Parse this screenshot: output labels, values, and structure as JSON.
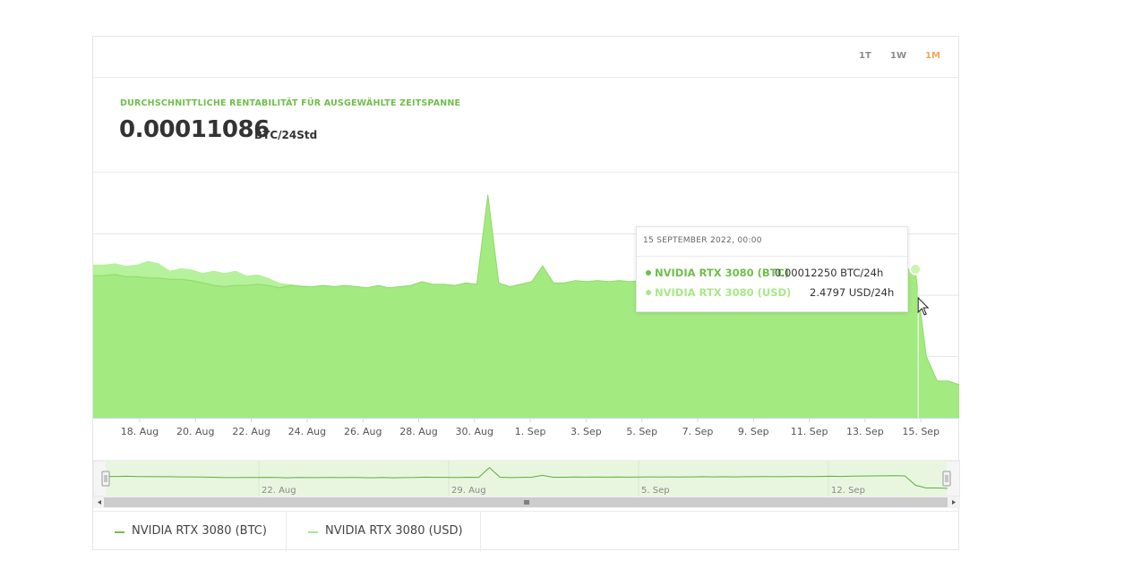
{
  "range_buttons": [
    {
      "label": "1T",
      "active": false
    },
    {
      "label": "1W",
      "active": false
    },
    {
      "label": "1M",
      "active": true
    }
  ],
  "summary": {
    "label": "DURCHSCHNITTLICHE RENTABILITÄT FÜR AUSGEWÄHLTE ZEITSPANNE",
    "value": "0.00011086",
    "unit": "BTC/24Std"
  },
  "tooltip": {
    "date": "15 SEPTEMBER 2022, 00:00",
    "rows": [
      {
        "name": "NVIDIA RTX 3080 (BTC)",
        "value": "0.00012250 BTC/24h",
        "color": "#6fbf4a"
      },
      {
        "name": "NVIDIA RTX 3080 (USD)",
        "value": "2.4797 USD/24h",
        "color": "#a8e88a"
      }
    ]
  },
  "legend": [
    {
      "label": "NVIDIA RTX 3080 (BTC)",
      "color": "#6fbf4a"
    },
    {
      "label": "NVIDIA RTX 3080 (USD)",
      "color": "#a8e88a"
    }
  ],
  "colors": {
    "btc_fill": "#a3ea80",
    "usd_fill": "#b6f19b",
    "line": "#5fae3d",
    "navigator_bg": "#e8f6e0",
    "range_active": "#f4a55a"
  },
  "chart_data": {
    "type": "area",
    "x_labels": [
      "18. Aug",
      "20. Aug",
      "22. Aug",
      "24. Aug",
      "26. Aug",
      "28. Aug",
      "30. Aug",
      "1. Sep",
      "3. Sep",
      "5. Sep",
      "7. Sep",
      "9. Sep",
      "11. Sep",
      "13. Sep",
      "15. Sep"
    ],
    "x_start": "2022-08-17",
    "x_end": "2022-09-16",
    "y_range": [
      0,
      0.0002
    ],
    "grid": true,
    "series": [
      {
        "name": "NVIDIA RTX 3080 (BTC)",
        "values": [
          0.000116,
          0.000116,
          0.000117,
          0.000115,
          0.000115,
          0.000114,
          0.000114,
          0.000113,
          0.000113,
          0.000112,
          0.00011,
          0.000108,
          0.000107,
          0.000108,
          0.000108,
          0.000109,
          0.000108,
          0.000106,
          0.000108,
          0.000107,
          0.000107,
          0.000108,
          0.000107,
          0.000108,
          0.000107,
          0.000106,
          0.000108,
          0.000106,
          0.000107,
          0.000108,
          0.000111,
          0.000109,
          0.000109,
          0.000108,
          0.00011,
          0.000109,
          0.000182,
          0.00011,
          0.000107,
          0.000109,
          0.000111,
          0.000124,
          0.00011,
          0.00011,
          0.000112,
          0.000111,
          0.000112,
          0.000111,
          0.000112,
          0.000111,
          0.000112,
          0.000113,
          0.000112,
          0.000113,
          0.000112,
          0.000113,
          0.000114,
          0.000113,
          0.000114,
          0.000113,
          0.000114,
          0.000114,
          0.000115,
          0.000114,
          0.000115,
          0.000116,
          0.000115,
          0.000116,
          0.000117,
          0.000116,
          0.000118,
          0.000119,
          0.00012,
          0.000121,
          0.000122,
          0.00012,
          5e-05,
          3e-05,
          3e-05,
          2.7e-05
        ]
      },
      {
        "name": "NVIDIA RTX 3080 (USD)",
        "values": [
          0.000125,
          0.000125,
          0.000126,
          0.000124,
          0.000125,
          0.000128,
          0.000126,
          0.00012,
          0.000122,
          0.000121,
          0.000118,
          0.00012,
          0.000118,
          0.00012,
          0.000116,
          0.000117,
          0.000114,
          0.00011,
          0.000109,
          0.000108,
          0.000107,
          0.000108,
          0.000107,
          0.000108,
          0.000107,
          0.000106,
          0.000108,
          0.000106,
          0.000107,
          0.000108,
          0.000111,
          0.000109,
          0.000109,
          0.000108,
          0.00011,
          0.000109,
          0.000182,
          0.00011,
          0.000107,
          0.000109,
          0.000111,
          0.000124,
          0.00011,
          0.00011,
          0.000112,
          0.000111,
          0.000112,
          0.000111,
          0.000112,
          0.000111,
          0.000112,
          0.000113,
          0.000112,
          0.000113,
          0.000112,
          0.000113,
          0.000114,
          0.000113,
          0.000114,
          0.000113,
          0.000114,
          0.000114,
          0.000115,
          0.000114,
          0.000115,
          0.000116,
          0.000115,
          0.000116,
          0.000117,
          0.000116,
          0.000118,
          0.000119,
          0.00012,
          0.000121,
          0.000122,
          0.00012,
          5e-05,
          3e-05,
          3e-05,
          2.7e-05
        ]
      }
    ],
    "navigator_labels": [
      "22. Aug",
      "29. Aug",
      "5. Sep",
      "12. Sep"
    ]
  }
}
